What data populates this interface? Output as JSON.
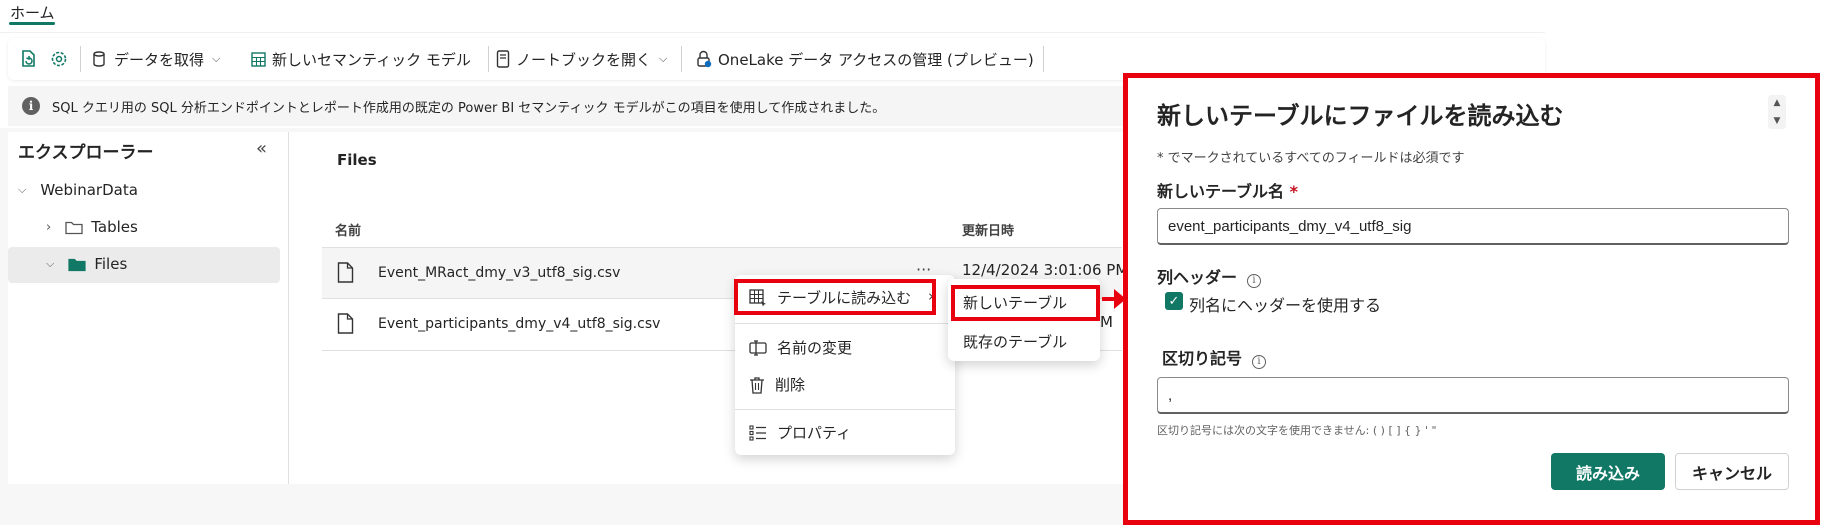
{
  "colors": {
    "accent": "#117865",
    "highlight_red": "#e8000f",
    "banner_bg": "#f5f5f5"
  },
  "top_tab": {
    "label": "ホーム"
  },
  "toolbar": {
    "items": [
      {
        "label": "データを取得",
        "icon": "database-icon",
        "has_dropdown": true
      },
      {
        "label": "新しいセマンティック モデル",
        "icon": "table-icon",
        "has_dropdown": false
      },
      {
        "label": "ノートブックを開く",
        "icon": "notebook-icon",
        "has_dropdown": true
      },
      {
        "label": "OneLake データ アクセスの管理 (プレビュー)",
        "icon": "lock-shield-icon",
        "has_dropdown": false
      }
    ]
  },
  "banner": {
    "text": "SQL クエリ用の SQL 分析エンドポイントとレポート作成用の既定の Power BI セマンティック モデルがこの項目を使用して作成されました。"
  },
  "explorer": {
    "title": "エクスプローラー",
    "root": "WebinarData",
    "children": [
      "Tables",
      "Files"
    ],
    "selected": "Files"
  },
  "files_view": {
    "title": "Files",
    "columns": {
      "name": "名前",
      "modified": "更新日時"
    },
    "rows": [
      {
        "name": "Event_MRact_dmy_v3_utf8_sig.csv",
        "modified": "12/4/2024 3:01:06 PM",
        "more": "···"
      },
      {
        "name": "Event_participants_dmy_v4_utf8_sig.csv",
        "modified": "M"
      }
    ]
  },
  "context_menu": {
    "items": [
      "テーブルに読み込む",
      "名前の変更",
      "削除",
      "プロパティ"
    ],
    "submenu_arrow": "›",
    "submenu": [
      "新しいテーブル",
      "既存のテーブル"
    ]
  },
  "dialog": {
    "title": "新しいテーブルにファイルを読み込む",
    "required_note": "* でマークされているすべてのフィールドは必須です",
    "table_name_label": "新しいテーブル名",
    "required_star": "*",
    "table_name_value": "event_participants_dmy_v4_utf8_sig",
    "header_label": "列ヘッダー",
    "header_checkbox_label": "列名にヘッダーを使用する",
    "header_checked": true,
    "delimiter_label": "区切り記号",
    "delimiter_value": ",",
    "delimiter_hint": "区切り記号には次の文字を使用できません: ( ) [ ] { } ' \"",
    "load_button": "読み込み",
    "cancel_button": "キャンセル"
  }
}
